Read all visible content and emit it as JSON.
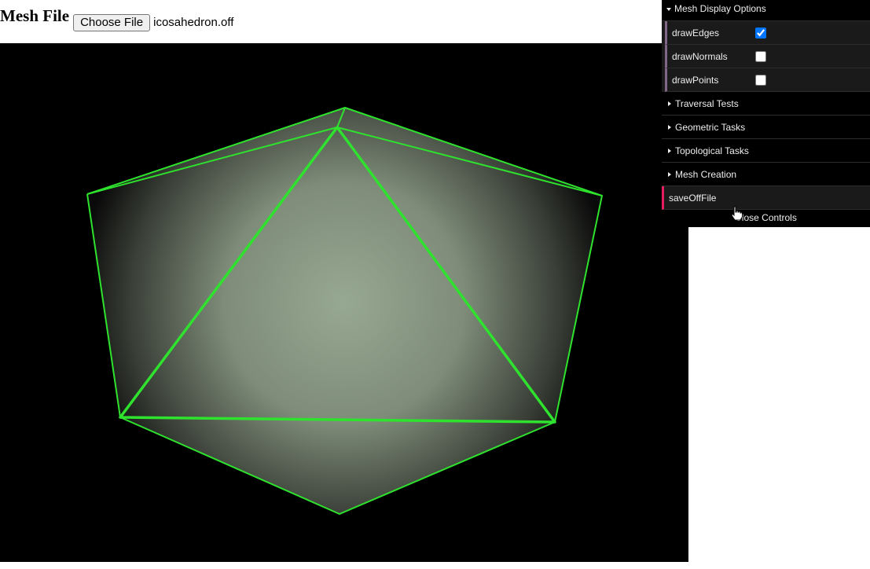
{
  "header": {
    "title": "Mesh File",
    "choose_file_label": "Choose File",
    "file_name": "icosahedron.off"
  },
  "viewport": {
    "background": "#000000",
    "edge_color": "#2ee22e",
    "face_color": "#97a892"
  },
  "gui": {
    "folder_title": "Mesh Display Options",
    "controls": [
      {
        "label": "drawEdges",
        "checked": true
      },
      {
        "label": "drawNormals",
        "checked": false
      },
      {
        "label": "drawPoints",
        "checked": false
      }
    ],
    "folders": [
      "Traversal Tests",
      "Geometric Tasks",
      "Topological Tasks",
      "Mesh Creation"
    ],
    "function_label": "saveOffFile",
    "close_label": "Close Controls"
  }
}
